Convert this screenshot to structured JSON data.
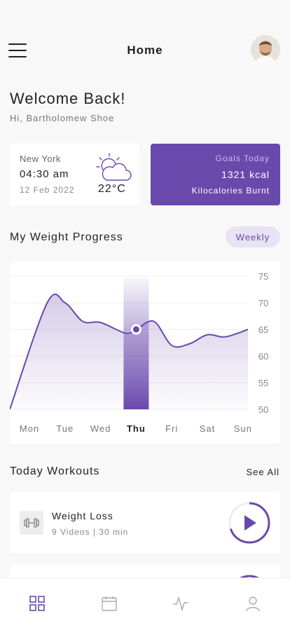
{
  "header": {
    "title": "Home"
  },
  "welcome": {
    "heading": "Welcome Back!",
    "greeting": "Hi, Bartholomew Shoe"
  },
  "weather": {
    "city": "New York",
    "time": "04:30 am",
    "date": "12 Feb 2022",
    "temperature": "22°C",
    "icon": "partly-cloudy-icon"
  },
  "goals": {
    "label": "Goals Today",
    "value": "1321 kcal",
    "subtitle": "Kilocalories Burnt"
  },
  "progress": {
    "title": "My Weight Progress",
    "filter": "Weekly"
  },
  "chart_data": {
    "type": "area",
    "x": [
      "Mon",
      "Tue",
      "Wed",
      "Thu",
      "Fri",
      "Sat",
      "Sun"
    ],
    "selected_category": "Thu",
    "y_ticks": [
      "75",
      "70",
      "65",
      "60",
      "55",
      "50"
    ],
    "ylim": [
      50,
      75
    ],
    "points": [
      [
        0,
        50
      ],
      [
        0.5,
        70
      ],
      [
        1,
        70
      ],
      [
        1.5,
        66.5
      ],
      [
        2,
        66.3
      ],
      [
        2.7,
        64.3
      ],
      [
        3,
        65
      ],
      [
        3.5,
        66.5
      ],
      [
        4,
        62
      ],
      [
        4.5,
        62.3
      ],
      [
        5,
        64
      ],
      [
        5.5,
        63.6
      ],
      [
        6,
        65
      ]
    ],
    "highlight_point": [
      3,
      65
    ],
    "grid": true,
    "accent": "#6a49ad"
  },
  "workouts": {
    "title": "Today Workouts",
    "see_all": "See All",
    "items": [
      {
        "title": "Weight Loss",
        "subtitle": "9 Videos | 30 min",
        "icon": "dumbbell-icon",
        "progress": 0.7
      }
    ]
  },
  "nav": {
    "items": [
      "grid-icon",
      "calendar-icon",
      "activity-icon",
      "profile-icon"
    ],
    "active": 0
  }
}
